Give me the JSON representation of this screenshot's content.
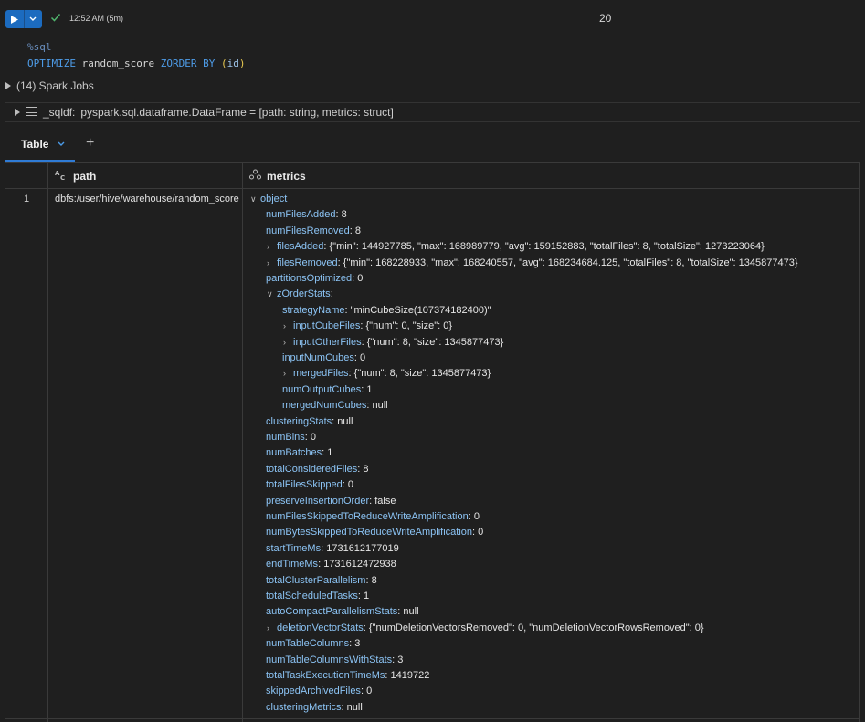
{
  "cell": {
    "runtime": "12:52 AM (5m)",
    "cell_number": "20"
  },
  "code": {
    "magic": "%sql",
    "kw1": "OPTIMIZE",
    "table": "random_score",
    "kw2": "ZORDER BY",
    "open": "(",
    "col": "id",
    "close": ")"
  },
  "jobs_label": "(14) Spark Jobs",
  "dataframe": {
    "name": "_sqldf:",
    "type": "pyspark.sql.dataframe.DataFrame = [path: string, metrics: struct]"
  },
  "tabs": {
    "table": "Table"
  },
  "columns": {
    "path": "path",
    "metrics": "metrics"
  },
  "row": {
    "index": "1",
    "path": "dbfs:/user/hive/warehouse/random_score"
  },
  "metrics_tree": [
    {
      "level": 0,
      "caret": "down",
      "key": "object",
      "value": ""
    },
    {
      "level": 1,
      "key": "numFilesAdded",
      "value": "8"
    },
    {
      "level": 1,
      "key": "numFilesRemoved",
      "value": "8"
    },
    {
      "level": 1,
      "caret": "right",
      "key": "filesAdded",
      "value": "{\"min\": 144927785, \"max\": 168989779, \"avg\": 159152883, \"totalFiles\": 8, \"totalSize\": 1273223064}"
    },
    {
      "level": 1,
      "caret": "right",
      "key": "filesRemoved",
      "value": "{\"min\": 168228933, \"max\": 168240557, \"avg\": 168234684.125, \"totalFiles\": 8, \"totalSize\": 1345877473}"
    },
    {
      "level": 1,
      "key": "partitionsOptimized",
      "value": "0"
    },
    {
      "level": 1,
      "caret": "down",
      "key": "zOrderStats",
      "value": ""
    },
    {
      "level": 2,
      "key": "strategyName",
      "value": "\"minCubeSize(107374182400)\""
    },
    {
      "level": 2,
      "caret": "right",
      "key": "inputCubeFiles",
      "value": "{\"num\": 0, \"size\": 0}"
    },
    {
      "level": 2,
      "caret": "right",
      "key": "inputOtherFiles",
      "value": "{\"num\": 8, \"size\": 1345877473}"
    },
    {
      "level": 2,
      "key": "inputNumCubes",
      "value": "0"
    },
    {
      "level": 2,
      "caret": "right",
      "key": "mergedFiles",
      "value": "{\"num\": 8, \"size\": 1345877473}"
    },
    {
      "level": 2,
      "key": "numOutputCubes",
      "value": "1"
    },
    {
      "level": 2,
      "key": "mergedNumCubes",
      "value": "null"
    },
    {
      "level": 1,
      "key": "clusteringStats",
      "value": "null"
    },
    {
      "level": 1,
      "key": "numBins",
      "value": "0"
    },
    {
      "level": 1,
      "key": "numBatches",
      "value": "1"
    },
    {
      "level": 1,
      "key": "totalConsideredFiles",
      "value": "8"
    },
    {
      "level": 1,
      "key": "totalFilesSkipped",
      "value": "0"
    },
    {
      "level": 1,
      "key": "preserveInsertionOrder",
      "value": "false"
    },
    {
      "level": 1,
      "key": "numFilesSkippedToReduceWriteAmplification",
      "value": "0"
    },
    {
      "level": 1,
      "key": "numBytesSkippedToReduceWriteAmplification",
      "value": "0"
    },
    {
      "level": 1,
      "key": "startTimeMs",
      "value": "1731612177019"
    },
    {
      "level": 1,
      "key": "endTimeMs",
      "value": "1731612472938"
    },
    {
      "level": 1,
      "key": "totalClusterParallelism",
      "value": "8"
    },
    {
      "level": 1,
      "key": "totalScheduledTasks",
      "value": "1"
    },
    {
      "level": 1,
      "key": "autoCompactParallelismStats",
      "value": "null"
    },
    {
      "level": 1,
      "caret": "right",
      "key": "deletionVectorStats",
      "value": "{\"numDeletionVectorsRemoved\": 0, \"numDeletionVectorRowsRemoved\": 0}"
    },
    {
      "level": 1,
      "key": "numTableColumns",
      "value": "3"
    },
    {
      "level": 1,
      "key": "numTableColumnsWithStats",
      "value": "3"
    },
    {
      "level": 1,
      "key": "totalTaskExecutionTimeMs",
      "value": "1419722"
    },
    {
      "level": 1,
      "key": "skippedArchivedFiles",
      "value": "0"
    },
    {
      "level": 1,
      "key": "clusteringMetrics",
      "value": "null"
    }
  ]
}
